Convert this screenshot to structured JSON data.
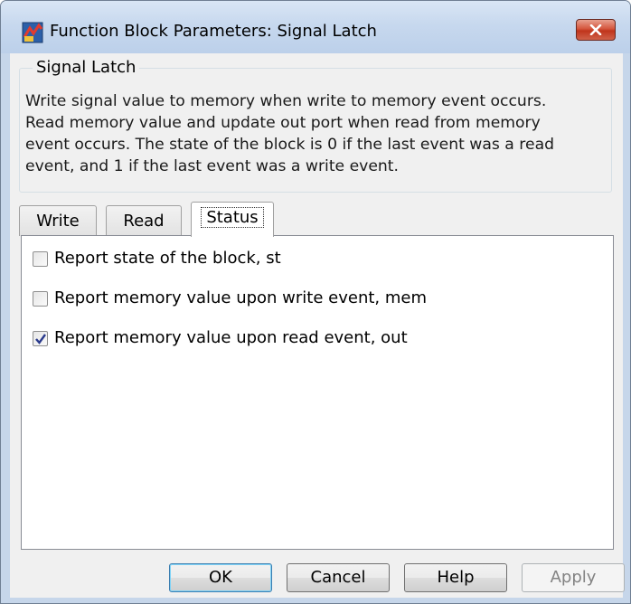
{
  "window": {
    "title": "Function Block Parameters: Signal Latch"
  },
  "block": {
    "name": "Signal Latch",
    "description": "Write signal value to memory when write to memory event occurs.\nRead memory value and update out port when read from memory\nevent occurs. The state of the block is 0 if the last event was a read\nevent, and 1 if the last event was a write event."
  },
  "tabs": [
    {
      "label": "Write",
      "active": false
    },
    {
      "label": "Read",
      "active": false
    },
    {
      "label": "Status",
      "active": true
    }
  ],
  "options": [
    {
      "label": "Report state of the block, st",
      "checked": false
    },
    {
      "label": "Report memory value upon write event, mem",
      "checked": false
    },
    {
      "label": "Report memory value upon read event, out",
      "checked": true
    }
  ],
  "buttons": {
    "ok": "OK",
    "cancel": "Cancel",
    "help": "Help",
    "apply": "Apply"
  },
  "colors": {
    "title_bar": "#c7d8ee",
    "close_button": "#c94a30",
    "checkmark": "#2a3a8c"
  },
  "icons": {
    "app": "simulink-block-icon",
    "close": "close-icon",
    "check": "checkmark-icon"
  }
}
